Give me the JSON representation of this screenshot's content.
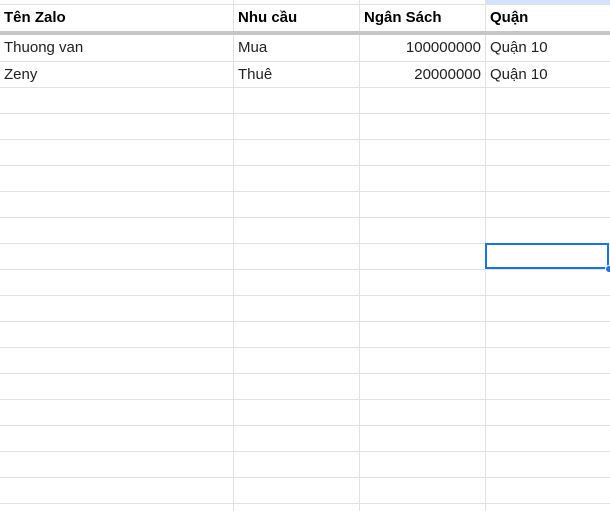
{
  "sheet": {
    "columns": [
      {
        "header": "Tên Zalo"
      },
      {
        "header": "Nhu cầu"
      },
      {
        "header": "Ngân Sách"
      },
      {
        "header": "Quận"
      }
    ],
    "rows": [
      {
        "ten_zalo": "Thuong van",
        "nhu_cau": "Mua",
        "ngan_sach": "100000000",
        "quan": "Quận 10"
      },
      {
        "ten_zalo": "Zeny",
        "nhu_cau": "Thuê",
        "ngan_sach": "20000000",
        "quan": "Quận 10"
      }
    ],
    "selected_cell": {
      "value": ""
    }
  },
  "colors": {
    "selection": "#1a73e8",
    "header_highlight": "#d3e3fd",
    "gridline": "#e2e2e2",
    "freeze_bar": "#c6c6c6"
  }
}
